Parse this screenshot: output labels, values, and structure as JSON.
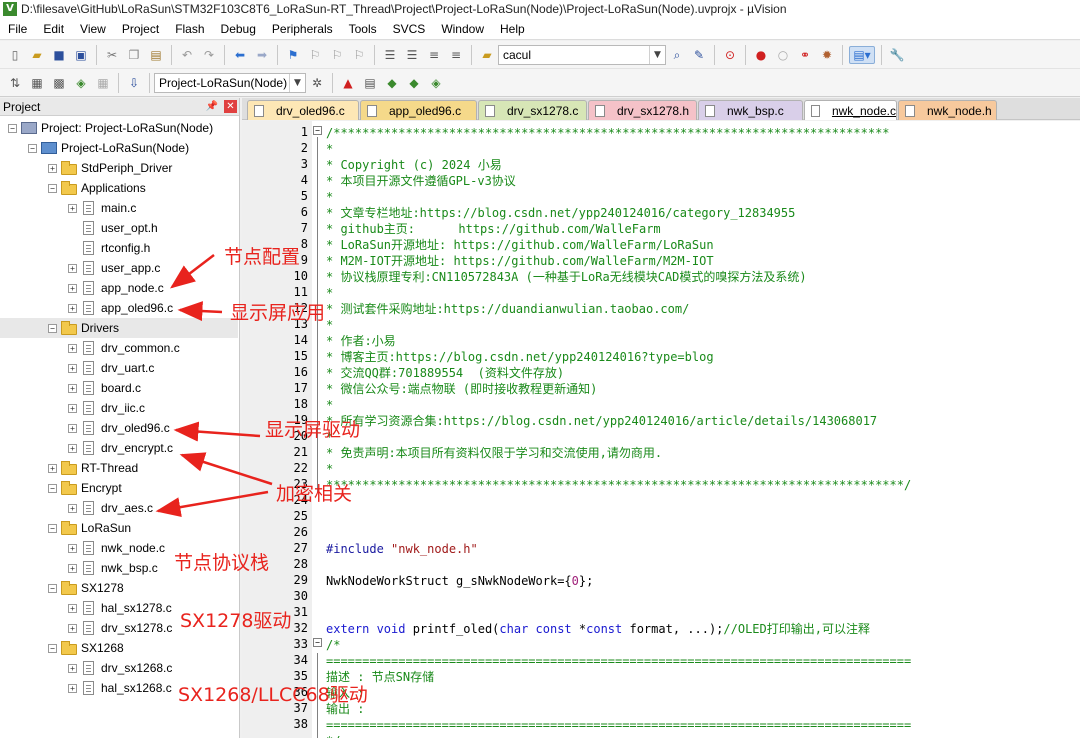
{
  "window": {
    "title": "D:\\filesave\\GitHub\\LoRaSun\\STM32F103C8T6_LoRaSun-RT_Thread\\Project\\Project-LoRaSun(Node)\\Project-LoRaSun(Node).uvprojx - µVision",
    "app_icon": "V"
  },
  "menu": [
    "File",
    "Edit",
    "View",
    "Project",
    "Flash",
    "Debug",
    "Peripherals",
    "Tools",
    "SVCS",
    "Window",
    "Help"
  ],
  "toolbar": {
    "find_value": "cacul",
    "target_value": "Project-LoRaSun(Node)"
  },
  "project_pane": {
    "title": "Project",
    "pin_icon": "pin-icon",
    "close_icon": "close-icon",
    "tree": [
      {
        "label": "Project: Project-LoRaSun(Node)",
        "level": 0,
        "icon": "project-icon",
        "exp": "-"
      },
      {
        "label": "Project-LoRaSun(Node)",
        "level": 1,
        "icon": "target-icon",
        "exp": "-"
      },
      {
        "label": "StdPeriph_Driver",
        "level": 2,
        "icon": "folder-icon",
        "exp": "+"
      },
      {
        "label": "Applications",
        "level": 2,
        "icon": "folder-icon",
        "exp": "-"
      },
      {
        "label": "main.c",
        "level": 3,
        "icon": "file-icon",
        "exp": "+"
      },
      {
        "label": "user_opt.h",
        "level": 3,
        "icon": "file-icon",
        "exp": ""
      },
      {
        "label": "rtconfig.h",
        "level": 3,
        "icon": "file-icon",
        "exp": ""
      },
      {
        "label": "user_app.c",
        "level": 3,
        "icon": "file-icon",
        "exp": "+"
      },
      {
        "label": "app_node.c",
        "level": 3,
        "icon": "file-icon",
        "exp": "+"
      },
      {
        "label": "app_oled96.c",
        "level": 3,
        "icon": "file-icon",
        "exp": "+"
      },
      {
        "label": "Drivers",
        "level": 2,
        "icon": "folder-icon",
        "exp": "-",
        "selected": true
      },
      {
        "label": "drv_common.c",
        "level": 3,
        "icon": "file-icon",
        "exp": "+"
      },
      {
        "label": "drv_uart.c",
        "level": 3,
        "icon": "file-icon",
        "exp": "+"
      },
      {
        "label": "board.c",
        "level": 3,
        "icon": "file-icon",
        "exp": "+"
      },
      {
        "label": "drv_iic.c",
        "level": 3,
        "icon": "file-icon",
        "exp": "+"
      },
      {
        "label": "drv_oled96.c",
        "level": 3,
        "icon": "file-icon",
        "exp": "+"
      },
      {
        "label": "drv_encrypt.c",
        "level": 3,
        "icon": "file-icon",
        "exp": "+"
      },
      {
        "label": "RT-Thread",
        "level": 2,
        "icon": "folder-icon",
        "exp": "+"
      },
      {
        "label": "Encrypt",
        "level": 2,
        "icon": "folder-icon",
        "exp": "-"
      },
      {
        "label": "drv_aes.c",
        "level": 3,
        "icon": "file-icon",
        "exp": "+"
      },
      {
        "label": "LoRaSun",
        "level": 2,
        "icon": "folder-icon",
        "exp": "-"
      },
      {
        "label": "nwk_node.c",
        "level": 3,
        "icon": "file-icon",
        "exp": "+"
      },
      {
        "label": "nwk_bsp.c",
        "level": 3,
        "icon": "file-icon",
        "exp": "+"
      },
      {
        "label": "SX1278",
        "level": 2,
        "icon": "folder-icon",
        "exp": "-"
      },
      {
        "label": "hal_sx1278.c",
        "level": 3,
        "icon": "file-icon",
        "exp": "+"
      },
      {
        "label": "drv_sx1278.c",
        "level": 3,
        "icon": "file-icon",
        "exp": "+"
      },
      {
        "label": "SX1268",
        "level": 2,
        "icon": "folder-icon",
        "exp": "-"
      },
      {
        "label": "drv_sx1268.c",
        "level": 3,
        "icon": "file-icon",
        "exp": "+"
      },
      {
        "label": "hal_sx1268.c",
        "level": 3,
        "icon": "file-icon",
        "exp": "+"
      }
    ]
  },
  "annotations": [
    {
      "text": "节点配置",
      "color": "#e8231d"
    },
    {
      "text": "显示屏应用",
      "color": "#e8231d"
    },
    {
      "text": "显示屏驱动",
      "color": "#e8231d"
    },
    {
      "text": "加密相关",
      "color": "#e8231d"
    },
    {
      "text": "节点协议栈",
      "color": "#e8231d"
    },
    {
      "text": "SX1278驱动",
      "color": "#e8231d"
    },
    {
      "text": "SX1268/LLCC68驱动",
      "color": "#e8231d"
    }
  ],
  "tabs": [
    {
      "label": "drv_oled96.c",
      "color": "#fde7b5"
    },
    {
      "label": "app_oled96.c",
      "color": "#f5d98a"
    },
    {
      "label": "drv_sx1278.c",
      "color": "#d7e6b6"
    },
    {
      "label": "drv_sx1278.h",
      "color": "#f5c2c8"
    },
    {
      "label": "nwk_bsp.c",
      "color": "#d9cfe9"
    },
    {
      "label": "nwk_node.c",
      "color": "#ffffff",
      "active": true
    },
    {
      "label": "nwk_node.h",
      "color": "#f7c99d"
    }
  ],
  "editor": {
    "line_numbers": [
      "1",
      "2",
      "3",
      "4",
      "5",
      "6",
      "7",
      "8",
      "9",
      "10",
      "11",
      "12",
      "13",
      "14",
      "15",
      "16",
      "17",
      "18",
      "19",
      "20",
      "21",
      "22",
      "23",
      "24",
      "25",
      "26",
      "27",
      "28",
      "29",
      "30",
      "31",
      "32",
      "33",
      "34",
      "35",
      "36",
      "37",
      "38"
    ],
    "lines": [
      {
        "n": 1,
        "segs": [
          {
            "t": "/*****************************************************************************",
            "c": "comment"
          }
        ]
      },
      {
        "n": 2,
        "segs": [
          {
            "t": "*",
            "c": "comment"
          }
        ]
      },
      {
        "n": 3,
        "segs": [
          {
            "t": "* Copyright (c) 2024 小易",
            "c": "comment"
          }
        ]
      },
      {
        "n": 4,
        "segs": [
          {
            "t": "* 本项目开源文件遵循GPL-v3协议",
            "c": "comment"
          }
        ]
      },
      {
        "n": 5,
        "segs": [
          {
            "t": "*",
            "c": "comment"
          }
        ]
      },
      {
        "n": 6,
        "segs": [
          {
            "t": "* 文章专栏地址:https://blog.csdn.net/ypp240124016/category_12834955",
            "c": "comment"
          }
        ]
      },
      {
        "n": 7,
        "segs": [
          {
            "t": "* github主页:      https://github.com/WalleFarm",
            "c": "comment"
          }
        ]
      },
      {
        "n": 8,
        "segs": [
          {
            "t": "* LoRaSun开源地址: https://github.com/WalleFarm/LoRaSun",
            "c": "comment"
          }
        ]
      },
      {
        "n": 9,
        "segs": [
          {
            "t": "* M2M-IOT开源地址: https://github.com/WalleFarm/M2M-IOT",
            "c": "comment"
          }
        ]
      },
      {
        "n": 10,
        "segs": [
          {
            "t": "* 协议栈原理专利:CN110572843A (一种基于LoRa无线模块CAD模式的嗅探方法及系统)",
            "c": "comment"
          }
        ]
      },
      {
        "n": 11,
        "segs": [
          {
            "t": "*",
            "c": "comment"
          }
        ]
      },
      {
        "n": 12,
        "segs": [
          {
            "t": "* 测试套件采购地址:https://duandianwulian.taobao.com/",
            "c": "comment"
          }
        ]
      },
      {
        "n": 13,
        "segs": [
          {
            "t": "*",
            "c": "comment"
          }
        ]
      },
      {
        "n": 14,
        "segs": [
          {
            "t": "* 作者:小易",
            "c": "comment"
          }
        ]
      },
      {
        "n": 15,
        "segs": [
          {
            "t": "* 博客主页:https://blog.csdn.net/ypp240124016?type=blog",
            "c": "comment"
          }
        ]
      },
      {
        "n": 16,
        "segs": [
          {
            "t": "* 交流QQ群:701889554  (资料文件存放)",
            "c": "comment"
          }
        ]
      },
      {
        "n": 17,
        "segs": [
          {
            "t": "* 微信公众号:端点物联 (即时接收教程更新通知)",
            "c": "comment"
          }
        ]
      },
      {
        "n": 18,
        "segs": [
          {
            "t": "*",
            "c": "comment"
          }
        ]
      },
      {
        "n": 19,
        "segs": [
          {
            "t": "* 所有学习资源合集:https://blog.csdn.net/ypp240124016/article/details/143068017",
            "c": "comment"
          }
        ]
      },
      {
        "n": 20,
        "segs": [
          {
            "t": "*",
            "c": "comment"
          }
        ]
      },
      {
        "n": 21,
        "segs": [
          {
            "t": "* 免责声明:本项目所有资料仅限于学习和交流使用,请勿商用.",
            "c": "comment"
          }
        ]
      },
      {
        "n": 22,
        "segs": [
          {
            "t": "*",
            "c": "comment"
          }
        ]
      },
      {
        "n": 23,
        "segs": [
          {
            "t": "********************************************************************************/",
            "c": "comment"
          }
        ]
      },
      {
        "n": 24,
        "segs": []
      },
      {
        "n": 25,
        "segs": []
      },
      {
        "n": 26,
        "segs": []
      },
      {
        "n": 27,
        "segs": [
          {
            "t": "#include ",
            "c": "pre"
          },
          {
            "t": "\"nwk_node.h\"",
            "c": "str"
          }
        ]
      },
      {
        "n": 28,
        "segs": []
      },
      {
        "n": 29,
        "segs": [
          {
            "t": "NwkNodeWorkStruct g_sNwkNodeWork={",
            "c": "norm"
          },
          {
            "t": "0",
            "c": "num"
          },
          {
            "t": "};",
            "c": "norm"
          }
        ]
      },
      {
        "n": 30,
        "segs": []
      },
      {
        "n": 31,
        "segs": []
      },
      {
        "n": 32,
        "segs": [
          {
            "t": "extern ",
            "c": "kw"
          },
          {
            "t": "void ",
            "c": "kw"
          },
          {
            "t": "printf_oled(",
            "c": "norm"
          },
          {
            "t": "char ",
            "c": "kw"
          },
          {
            "t": "const ",
            "c": "kw"
          },
          {
            "t": "*",
            "c": "norm"
          },
          {
            "t": "const ",
            "c": "kw"
          },
          {
            "t": "format, ...);",
            "c": "norm"
          },
          {
            "t": "//OLED打印输出,可以注释",
            "c": "comment"
          }
        ]
      },
      {
        "n": 33,
        "segs": [
          {
            "t": "/*",
            "c": "comment"
          }
        ]
      },
      {
        "n": 34,
        "segs": [
          {
            "t": "=================================================================================",
            "c": "comment"
          }
        ]
      },
      {
        "n": 35,
        "segs": [
          {
            "t": "描述 : 节点SN存储",
            "c": "comment"
          }
        ]
      },
      {
        "n": 36,
        "segs": [
          {
            "t": "输入 :",
            "c": "comment"
          }
        ]
      },
      {
        "n": 37,
        "segs": [
          {
            "t": "输出 :",
            "c": "comment"
          }
        ]
      },
      {
        "n": 38,
        "segs": [
          {
            "t": "=================================================================================",
            "c": "comment"
          }
        ]
      }
    ],
    "tail_line": "*/"
  }
}
